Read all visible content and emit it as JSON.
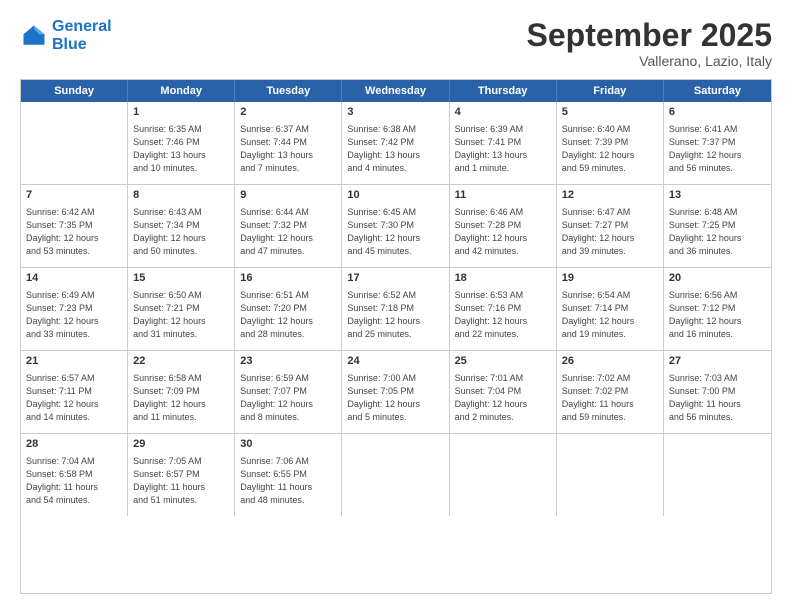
{
  "header": {
    "logo_line1": "General",
    "logo_line2": "Blue",
    "month": "September 2025",
    "location": "Vallerano, Lazio, Italy"
  },
  "weekdays": [
    "Sunday",
    "Monday",
    "Tuesday",
    "Wednesday",
    "Thursday",
    "Friday",
    "Saturday"
  ],
  "rows": [
    [
      {
        "day": "",
        "text": ""
      },
      {
        "day": "1",
        "text": "Sunrise: 6:35 AM\nSunset: 7:46 PM\nDaylight: 13 hours\nand 10 minutes."
      },
      {
        "day": "2",
        "text": "Sunrise: 6:37 AM\nSunset: 7:44 PM\nDaylight: 13 hours\nand 7 minutes."
      },
      {
        "day": "3",
        "text": "Sunrise: 6:38 AM\nSunset: 7:42 PM\nDaylight: 13 hours\nand 4 minutes."
      },
      {
        "day": "4",
        "text": "Sunrise: 6:39 AM\nSunset: 7:41 PM\nDaylight: 13 hours\nand 1 minute."
      },
      {
        "day": "5",
        "text": "Sunrise: 6:40 AM\nSunset: 7:39 PM\nDaylight: 12 hours\nand 59 minutes."
      },
      {
        "day": "6",
        "text": "Sunrise: 6:41 AM\nSunset: 7:37 PM\nDaylight: 12 hours\nand 56 minutes."
      }
    ],
    [
      {
        "day": "7",
        "text": "Sunrise: 6:42 AM\nSunset: 7:35 PM\nDaylight: 12 hours\nand 53 minutes."
      },
      {
        "day": "8",
        "text": "Sunrise: 6:43 AM\nSunset: 7:34 PM\nDaylight: 12 hours\nand 50 minutes."
      },
      {
        "day": "9",
        "text": "Sunrise: 6:44 AM\nSunset: 7:32 PM\nDaylight: 12 hours\nand 47 minutes."
      },
      {
        "day": "10",
        "text": "Sunrise: 6:45 AM\nSunset: 7:30 PM\nDaylight: 12 hours\nand 45 minutes."
      },
      {
        "day": "11",
        "text": "Sunrise: 6:46 AM\nSunset: 7:28 PM\nDaylight: 12 hours\nand 42 minutes."
      },
      {
        "day": "12",
        "text": "Sunrise: 6:47 AM\nSunset: 7:27 PM\nDaylight: 12 hours\nand 39 minutes."
      },
      {
        "day": "13",
        "text": "Sunrise: 6:48 AM\nSunset: 7:25 PM\nDaylight: 12 hours\nand 36 minutes."
      }
    ],
    [
      {
        "day": "14",
        "text": "Sunrise: 6:49 AM\nSunset: 7:23 PM\nDaylight: 12 hours\nand 33 minutes."
      },
      {
        "day": "15",
        "text": "Sunrise: 6:50 AM\nSunset: 7:21 PM\nDaylight: 12 hours\nand 31 minutes."
      },
      {
        "day": "16",
        "text": "Sunrise: 6:51 AM\nSunset: 7:20 PM\nDaylight: 12 hours\nand 28 minutes."
      },
      {
        "day": "17",
        "text": "Sunrise: 6:52 AM\nSunset: 7:18 PM\nDaylight: 12 hours\nand 25 minutes."
      },
      {
        "day": "18",
        "text": "Sunrise: 6:53 AM\nSunset: 7:16 PM\nDaylight: 12 hours\nand 22 minutes."
      },
      {
        "day": "19",
        "text": "Sunrise: 6:54 AM\nSunset: 7:14 PM\nDaylight: 12 hours\nand 19 minutes."
      },
      {
        "day": "20",
        "text": "Sunrise: 6:56 AM\nSunset: 7:12 PM\nDaylight: 12 hours\nand 16 minutes."
      }
    ],
    [
      {
        "day": "21",
        "text": "Sunrise: 6:57 AM\nSunset: 7:11 PM\nDaylight: 12 hours\nand 14 minutes."
      },
      {
        "day": "22",
        "text": "Sunrise: 6:58 AM\nSunset: 7:09 PM\nDaylight: 12 hours\nand 11 minutes."
      },
      {
        "day": "23",
        "text": "Sunrise: 6:59 AM\nSunset: 7:07 PM\nDaylight: 12 hours\nand 8 minutes."
      },
      {
        "day": "24",
        "text": "Sunrise: 7:00 AM\nSunset: 7:05 PM\nDaylight: 12 hours\nand 5 minutes."
      },
      {
        "day": "25",
        "text": "Sunrise: 7:01 AM\nSunset: 7:04 PM\nDaylight: 12 hours\nand 2 minutes."
      },
      {
        "day": "26",
        "text": "Sunrise: 7:02 AM\nSunset: 7:02 PM\nDaylight: 11 hours\nand 59 minutes."
      },
      {
        "day": "27",
        "text": "Sunrise: 7:03 AM\nSunset: 7:00 PM\nDaylight: 11 hours\nand 56 minutes."
      }
    ],
    [
      {
        "day": "28",
        "text": "Sunrise: 7:04 AM\nSunset: 6:58 PM\nDaylight: 11 hours\nand 54 minutes."
      },
      {
        "day": "29",
        "text": "Sunrise: 7:05 AM\nSunset: 6:57 PM\nDaylight: 11 hours\nand 51 minutes."
      },
      {
        "day": "30",
        "text": "Sunrise: 7:06 AM\nSunset: 6:55 PM\nDaylight: 11 hours\nand 48 minutes."
      },
      {
        "day": "",
        "text": ""
      },
      {
        "day": "",
        "text": ""
      },
      {
        "day": "",
        "text": ""
      },
      {
        "day": "",
        "text": ""
      }
    ]
  ]
}
